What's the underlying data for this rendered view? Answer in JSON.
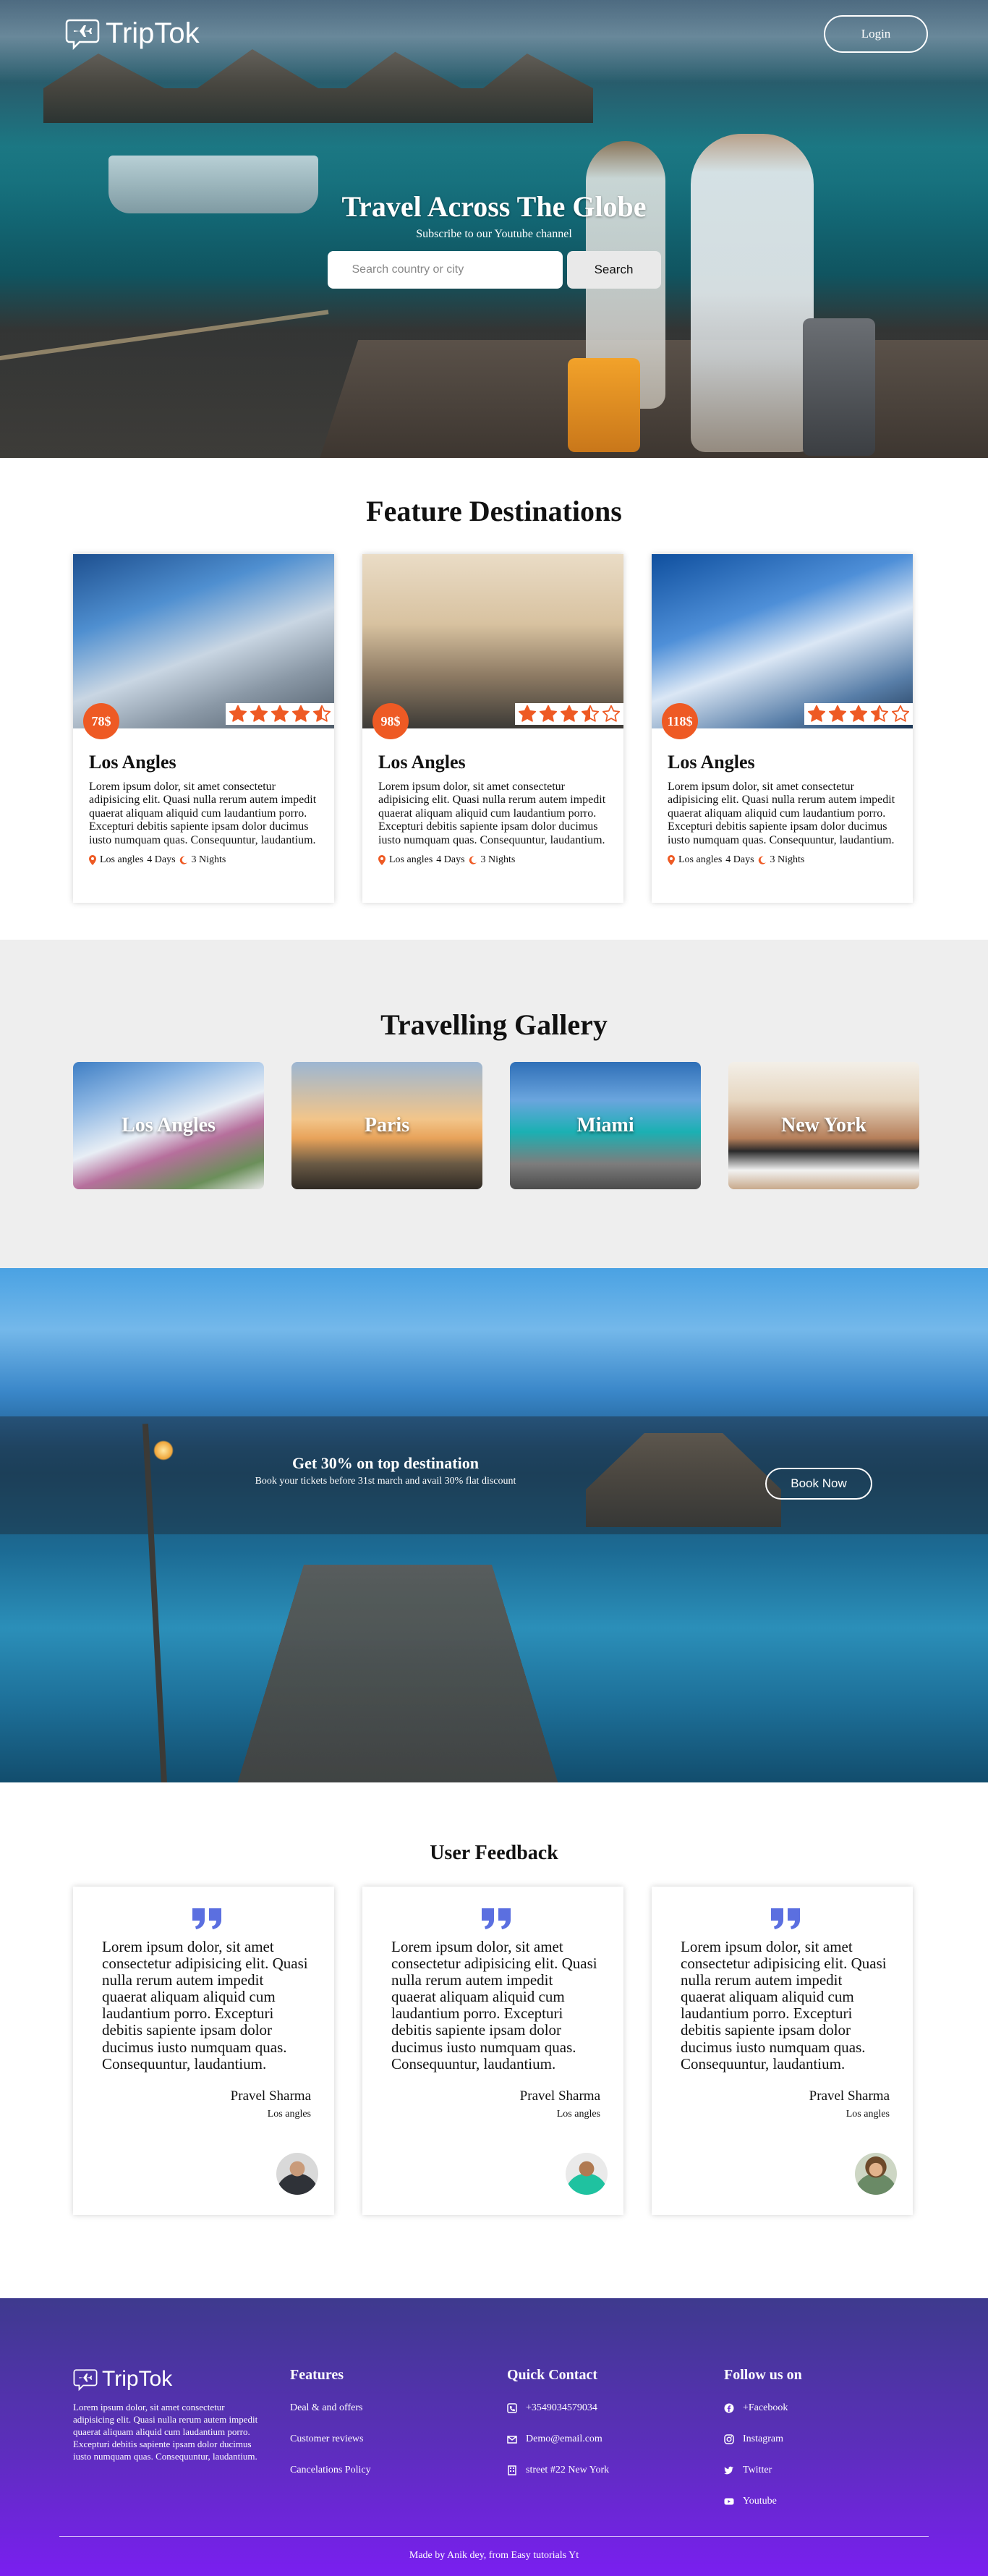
{
  "brand": {
    "name": "TripTok"
  },
  "nav": {
    "login_label": "Login"
  },
  "hero": {
    "title": "Travel Across The Globe",
    "subtitle": "Subscribe to our Youtube channel",
    "search_placeholder": "Search country or city",
    "search_button": "Search"
  },
  "feature": {
    "title": "Feature Destinations",
    "cards": [
      {
        "price": "78$",
        "rating": 4.5,
        "title": "Los Angles",
        "desc": "Lorem ipsum dolor, sit amet consectetur adipisicing elit. Quasi nulla rerum autem impedit quaerat aliquam aliquid cum laudantium porro. Excepturi debitis sapiente ipsam dolor ducimus iusto numquam quas. Consequuntur, laudantium.",
        "location": "Los angles",
        "days": "4 Days",
        "nights": "3 Nights"
      },
      {
        "price": "98$",
        "rating": 3.5,
        "title": "Los Angles",
        "desc": "Lorem ipsum dolor, sit amet consectetur adipisicing elit. Quasi nulla rerum autem impedit quaerat aliquam aliquid cum laudantium porro. Excepturi debitis sapiente ipsam dolor ducimus iusto numquam quas. Consequuntur, laudantium.",
        "location": "Los angles",
        "days": "4 Days",
        "nights": "3 Nights"
      },
      {
        "price": "118$",
        "rating": 3.5,
        "title": "Los Angles",
        "desc": "Lorem ipsum dolor, sit amet consectetur adipisicing elit. Quasi nulla rerum autem impedit quaerat aliquam aliquid cum laudantium porro. Excepturi debitis sapiente ipsam dolor ducimus iusto numquam quas. Consequuntur, laudantium.",
        "location": "Los angles",
        "days": "4 Days",
        "nights": "3 Nights"
      }
    ]
  },
  "gallery": {
    "title": "Travelling Gallery",
    "items": [
      "Los Angles",
      "Paris",
      "Miami",
      "New York"
    ]
  },
  "offer": {
    "title": "Get 30% on top destination",
    "subtitle": "Book your tickets before 31st march and avail 30% flat discount",
    "button": "Book Now"
  },
  "feedback": {
    "title": "User Feedback",
    "items": [
      {
        "text": "Lorem ipsum dolor, sit amet consectetur adipisicing elit. Quasi nulla rerum autem impedit quaerat aliquam aliquid cum laudantium porro. Excepturi debitis sapiente ipsam dolor ducimus iusto numquam quas. Consequuntur, laudantium.",
        "name": "Pravel Sharma",
        "location": "Los angles"
      },
      {
        "text": "Lorem ipsum dolor, sit amet consectetur adipisicing elit. Quasi nulla rerum autem impedit quaerat aliquam aliquid cum laudantium porro. Excepturi debitis sapiente ipsam dolor ducimus iusto numquam quas. Consequuntur, laudantium.",
        "name": "Pravel Sharma",
        "location": "Los angles"
      },
      {
        "text": "Lorem ipsum dolor, sit amet consectetur adipisicing elit. Quasi nulla rerum autem impedit quaerat aliquam aliquid cum laudantium porro. Excepturi debitis sapiente ipsam dolor ducimus iusto numquam quas. Consequuntur, laudantium.",
        "name": "Pravel Sharma",
        "location": "Los angles"
      }
    ]
  },
  "footer": {
    "brand": "TripTok",
    "desc": "Lorem ipsum dolor, sit amet consectetur adipisicing elit. Quasi nulla rerum autem impedit quaerat aliquam aliquid cum laudantium porro. Excepturi debitis sapiente ipsam dolor ducimus iusto numquam quas. Consequuntur, laudantium.",
    "features": {
      "heading": "Features",
      "links": [
        "Deal & and offers",
        "Customer reviews",
        "Cancelations Policy"
      ]
    },
    "contact": {
      "heading": "Quick Contact",
      "phone": "+3549034579034",
      "email": "Demo@email.com",
      "address": "street #22 New York"
    },
    "follow": {
      "heading": "Follow us on",
      "links": [
        "+Facebook",
        "Instagram",
        "Twitter",
        "Youtube"
      ]
    },
    "credit": "Made by Anik dey, from Easy tutorials Yt"
  },
  "colors": {
    "accent": "#ee5a24",
    "footer_top": "#3e3a8e",
    "footer_bottom": "#7a1ff0"
  }
}
